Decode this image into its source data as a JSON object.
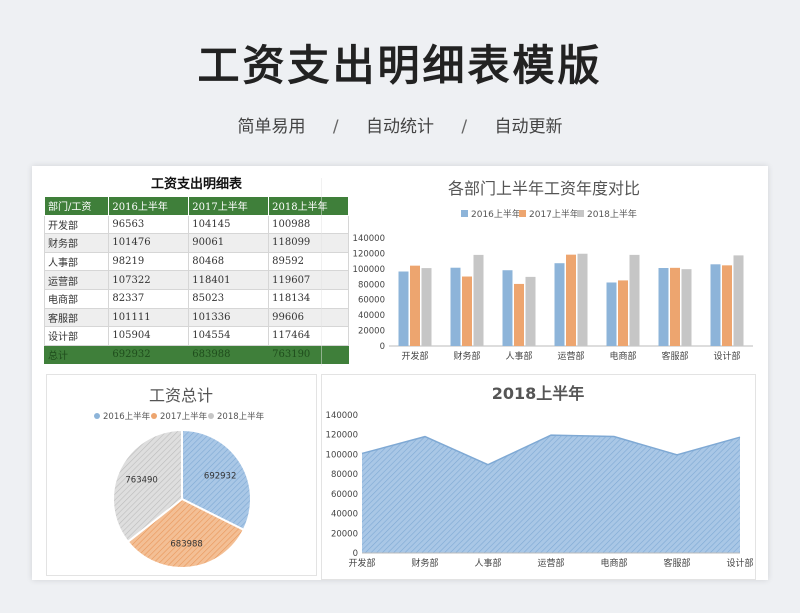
{
  "page": {
    "title": "工资支出明细表模版",
    "subtitle_items": [
      "简单易用",
      "自动统计",
      "自动更新"
    ],
    "separator": "/"
  },
  "table": {
    "title": "工资支出明细表",
    "headers": [
      "部门/工资",
      "2016上半年",
      "2017上半年",
      "2018上半年"
    ],
    "rows": [
      [
        "开发部",
        "96563",
        "104145",
        "100988"
      ],
      [
        "财务部",
        "101476",
        "90061",
        "118099"
      ],
      [
        "人事部",
        "98219",
        "80468",
        "89592"
      ],
      [
        "运营部",
        "107322",
        "118401",
        "119607"
      ],
      [
        "电商部",
        "82337",
        "85023",
        "118134"
      ],
      [
        "客服部",
        "101111",
        "101336",
        "99606"
      ],
      [
        "设计部",
        "105904",
        "104554",
        "117464"
      ]
    ],
    "total": [
      "总计",
      "692932",
      "683988",
      "763190"
    ]
  },
  "colors": {
    "s2016": "#8db4d9",
    "s2017": "#eda56f",
    "s2018": "#c6c6c6",
    "header_green": "#3f7f3a"
  },
  "chart_data": [
    {
      "type": "bar",
      "title": "各部门上半年工资年度对比",
      "categories": [
        "开发部",
        "财务部",
        "人事部",
        "运营部",
        "电商部",
        "客服部",
        "设计部"
      ],
      "series": [
        {
          "name": "2016上半年",
          "values": [
            96563,
            101476,
            98219,
            107322,
            82337,
            101111,
            105904
          ]
        },
        {
          "name": "2017上半年",
          "values": [
            104145,
            90061,
            80468,
            118401,
            85023,
            101336,
            104554
          ]
        },
        {
          "name": "2018上半年",
          "values": [
            100988,
            118099,
            89592,
            119607,
            118134,
            99606,
            117464
          ]
        }
      ],
      "ylim": [
        0,
        140000
      ],
      "yticks": [
        "0",
        "20000",
        "40000",
        "60000",
        "80000",
        "100000",
        "120000",
        "140000"
      ],
      "legend": "top"
    },
    {
      "type": "pie",
      "title": "工资总计",
      "series": [
        {
          "name": "2016上半年",
          "value": 692932,
          "label": "692932"
        },
        {
          "name": "2017上半年",
          "value": 683988,
          "label": "683988"
        },
        {
          "name": "2018上半年",
          "value": 763190,
          "label": "763490"
        }
      ],
      "legend": "top"
    },
    {
      "type": "area",
      "title": "2018上半年",
      "categories": [
        "开发部",
        "财务部",
        "人事部",
        "运营部",
        "电商部",
        "客服部",
        "设计部"
      ],
      "values": [
        100988,
        118099,
        89592,
        119607,
        118134,
        99606,
        117464
      ],
      "ylim": [
        0,
        140000
      ],
      "yticks": [
        "0",
        "20000",
        "40000",
        "60000",
        "80000",
        "100000",
        "120000",
        "140000"
      ]
    }
  ]
}
